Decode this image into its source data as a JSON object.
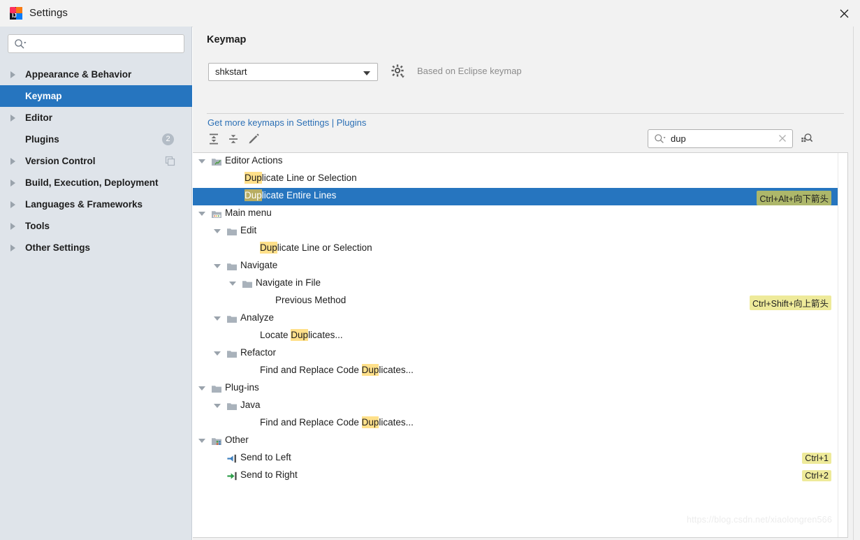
{
  "window": {
    "title": "Settings",
    "app_icon": "intellij-idea-logo",
    "close_icon": "close-icon"
  },
  "sidebar": {
    "search": {
      "placeholder": "",
      "value": "",
      "icon": "search-icon"
    },
    "items": [
      {
        "label": "Appearance & Behavior",
        "expandable": true,
        "selected": false
      },
      {
        "label": "Keymap",
        "expandable": false,
        "selected": true
      },
      {
        "label": "Editor",
        "expandable": true,
        "selected": false
      },
      {
        "label": "Plugins",
        "expandable": false,
        "selected": false,
        "badge": "2"
      },
      {
        "label": "Version Control",
        "expandable": true,
        "selected": false,
        "icon": "copy-icon"
      },
      {
        "label": "Build, Execution, Deployment",
        "expandable": true,
        "selected": false
      },
      {
        "label": "Languages & Frameworks",
        "expandable": true,
        "selected": false
      },
      {
        "label": "Tools",
        "expandable": true,
        "selected": false
      },
      {
        "label": "Other Settings",
        "expandable": true,
        "selected": false
      }
    ]
  },
  "main": {
    "title": "Keymap",
    "keymap_select": {
      "value": "shkstart",
      "caret_icon": "chevron-down-icon"
    },
    "gear_icon": "gear-icon",
    "based_on": "Based on Eclipse keymap",
    "more_keymaps_link": "Get more keymaps in Settings | Plugins",
    "toolbar": {
      "expand_all_icon": "expand-all-icon",
      "collapse_all_icon": "collapse-all-icon",
      "edit_icon": "pencil-edit-icon",
      "search": {
        "value": "dup",
        "placeholder": "",
        "icon": "search-icon",
        "clear_icon": "clear-icon"
      },
      "find_by_shortcut_icon": "find-by-shortcut-icon"
    },
    "tree": [
      {
        "label": "Editor Actions",
        "indent": 0,
        "twisty": "down",
        "icon": "editor-actions-icon",
        "highlight": "",
        "shortcut": "",
        "selected": false
      },
      {
        "label": "Duplicate Line or Selection",
        "indent": 2,
        "twisty": "",
        "icon": "",
        "highlight": "Dup",
        "shortcut": "",
        "selected": false
      },
      {
        "label": "Duplicate Entire Lines",
        "indent": 2,
        "twisty": "",
        "icon": "",
        "highlight": "Dup",
        "shortcut": "Ctrl+Alt+向下箭头",
        "selected": true
      },
      {
        "label": "Main menu",
        "indent": 0,
        "twisty": "down",
        "icon": "main-menu-icon",
        "highlight": "",
        "shortcut": "",
        "selected": false
      },
      {
        "label": "Edit",
        "indent": 1,
        "twisty": "down",
        "icon": "folder-icon",
        "highlight": "",
        "shortcut": "",
        "selected": false
      },
      {
        "label": "Duplicate Line or Selection",
        "indent": 3,
        "twisty": "",
        "icon": "",
        "highlight": "Dup",
        "shortcut": "",
        "selected": false
      },
      {
        "label": "Navigate",
        "indent": 1,
        "twisty": "down",
        "icon": "folder-icon",
        "highlight": "",
        "shortcut": "",
        "selected": false
      },
      {
        "label": "Navigate in File",
        "indent": 2,
        "twisty": "down",
        "icon": "folder-icon",
        "highlight": "",
        "shortcut": "",
        "selected": false
      },
      {
        "label": "Previous Method",
        "indent": 4,
        "twisty": "",
        "icon": "",
        "highlight": "",
        "shortcut": "Ctrl+Shift+向上箭头",
        "selected": false
      },
      {
        "label": "Analyze",
        "indent": 1,
        "twisty": "down",
        "icon": "folder-icon",
        "highlight": "",
        "shortcut": "",
        "selected": false
      },
      {
        "label": "Locate Duplicates...",
        "indent": 3,
        "twisty": "",
        "icon": "",
        "highlight": "Dup",
        "shortcut": "",
        "selected": false
      },
      {
        "label": "Refactor",
        "indent": 1,
        "twisty": "down",
        "icon": "folder-icon",
        "highlight": "",
        "shortcut": "",
        "selected": false
      },
      {
        "label": "Find and Replace Code Duplicates...",
        "indent": 3,
        "twisty": "",
        "icon": "",
        "highlight": "Dup",
        "shortcut": "",
        "selected": false
      },
      {
        "label": "Plug-ins",
        "indent": 0,
        "twisty": "down",
        "icon": "folder-icon",
        "highlight": "",
        "shortcut": "",
        "selected": false
      },
      {
        "label": "Java",
        "indent": 1,
        "twisty": "down",
        "icon": "folder-icon",
        "highlight": "",
        "shortcut": "",
        "selected": false
      },
      {
        "label": "Find and Replace Code Duplicates...",
        "indent": 3,
        "twisty": "",
        "icon": "",
        "highlight": "Dup",
        "shortcut": "",
        "selected": false
      },
      {
        "label": "Other",
        "indent": 0,
        "twisty": "down",
        "icon": "other-icon",
        "highlight": "",
        "shortcut": "",
        "selected": false
      },
      {
        "label": "Send to Left",
        "indent": 1,
        "twisty": "",
        "icon": "send-left-icon",
        "highlight": "",
        "shortcut": "Ctrl+1",
        "selected": false
      },
      {
        "label": "Send to Right",
        "indent": 1,
        "twisty": "",
        "icon": "send-right-icon",
        "highlight": "",
        "shortcut": "Ctrl+2",
        "selected": false
      }
    ]
  },
  "watermark": "https://blog.csdn.net/xiaolongren566",
  "colors": {
    "selection": "#2675bf",
    "sidebar_bg": "#dfe4ea",
    "panel_bg": "#f2f2f2",
    "link": "#2b6fb5",
    "highlight": "#ffe08a",
    "shortcut_bg": "#eeea9a"
  }
}
